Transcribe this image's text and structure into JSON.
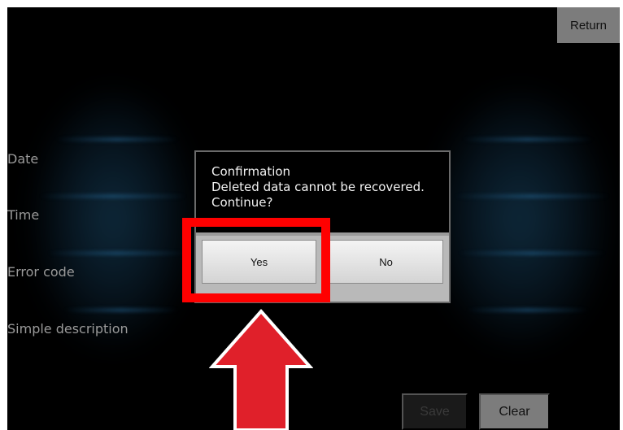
{
  "header": {
    "return_label": "Return"
  },
  "fields": {
    "date": "Date",
    "time": "Time",
    "error_code": "Error code",
    "simple_description": "Simple description"
  },
  "dialog": {
    "title": "Confirmation",
    "message_line1": "Deleted data cannot be recovered.",
    "message_line2": "Continue?",
    "yes_label": "Yes",
    "no_label": "No"
  },
  "footer": {
    "save_label": "Save",
    "clear_label": "Clear"
  },
  "annotation": {
    "highlight_color": "#ff0000",
    "arrow_color": "#e0202a",
    "arrow_icon": "arrow-up-icon"
  },
  "colors": {
    "background": "#000000",
    "button_gray": "#7c7c7c",
    "label_gray": "#9a9a9a"
  }
}
